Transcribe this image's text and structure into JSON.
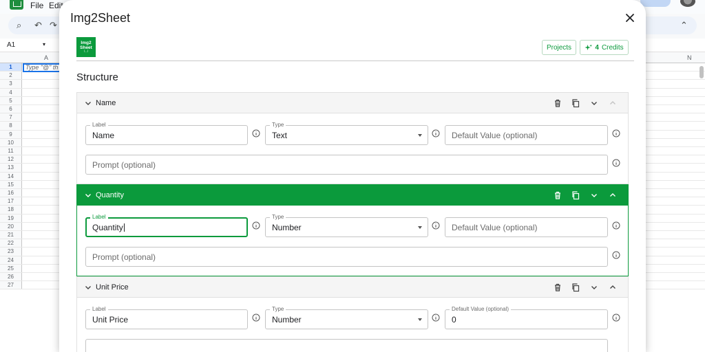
{
  "sheets": {
    "menu": [
      "File",
      "Edit"
    ],
    "cell_ref": "A1",
    "col_a": "A",
    "col_n": "N",
    "a1_placeholder": "Type \"@\" th",
    "rows": [
      "1",
      "2",
      "3",
      "4",
      "5",
      "6",
      "7",
      "8",
      "9",
      "10",
      "11",
      "12",
      "13",
      "14",
      "15",
      "16",
      "17",
      "18",
      "19",
      "20",
      "21",
      "22",
      "23",
      "24",
      "25",
      "26",
      "27"
    ]
  },
  "modal": {
    "title": "Img2Sheet",
    "logo_text": "Img2\nSheet",
    "projects_label": "Projects",
    "credits_count": "4",
    "credits_label": "Credits",
    "section_title": "Structure"
  },
  "fields": [
    {
      "name": "Name",
      "label_caption": "Label",
      "label_value": "Name",
      "type_caption": "Type",
      "type_value": "Text",
      "default_placeholder": "Default Value (optional)",
      "prompt_placeholder": "Prompt (optional)"
    },
    {
      "name": "Quantity",
      "label_caption": "Label",
      "label_value": "Quantity",
      "type_caption": "Type",
      "type_value": "Number",
      "default_placeholder": "Default Value (optional)",
      "prompt_placeholder": "Prompt (optional)"
    },
    {
      "name": "Unit Price",
      "label_caption": "Label",
      "label_value": "Unit Price",
      "type_caption": "Type",
      "type_value": "Number",
      "default_caption": "Default Value (optional)",
      "default_value": "0"
    }
  ],
  "colors": {
    "accent": "#0b9a3c",
    "sheets_green": "#1e8e3e",
    "selection_blue": "#1a73e8"
  },
  "icons": [
    "close-icon",
    "sparkle-icon",
    "chevron-down-icon",
    "trash-icon",
    "copy-icon",
    "move-down-icon",
    "move-up-icon",
    "info-icon"
  ]
}
